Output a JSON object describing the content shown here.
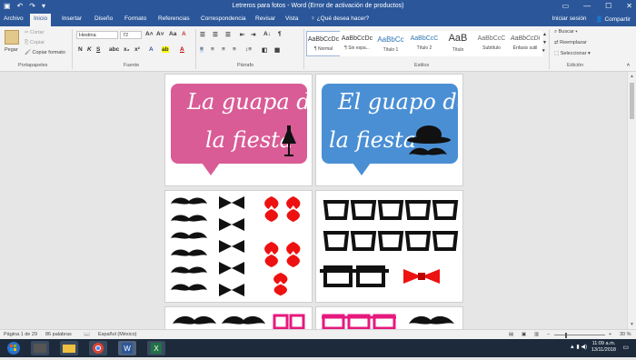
{
  "window": {
    "title": "Letreros para fotos - Word (Error de activación de productos)"
  },
  "tabs": [
    "Archivo",
    "Inicio",
    "Insertar",
    "Diseño",
    "Formato",
    "Referencias",
    "Correspondencia",
    "Revisar",
    "Vista"
  ],
  "tell_me": "¿Qué desea hacer?",
  "account": {
    "signin": "Iniciar sesión",
    "share": "Compartir"
  },
  "clipboard": {
    "paste": "Pegar",
    "cut": "Cortar",
    "copy": "Copiar",
    "format_painter": "Copiar formato",
    "label": "Portapapeles"
  },
  "font": {
    "name": "Hestina",
    "size": "72",
    "label": "Fuente"
  },
  "paragraph": {
    "label": "Párrafo"
  },
  "styles": {
    "label": "Estilos",
    "items": [
      {
        "preview": "AaBbCcDc",
        "name": "¶ Normal"
      },
      {
        "preview": "AaBbCcDc",
        "name": "¶ Sin espa..."
      },
      {
        "preview": "AaBbCc",
        "name": "Título 1"
      },
      {
        "preview": "AaBbCcC",
        "name": "Título 2"
      },
      {
        "preview": "AaB",
        "name": "Título"
      },
      {
        "preview": "AaBbCcC",
        "name": "Subtítulo"
      },
      {
        "preview": "AaBbCcDi",
        "name": "Énfasis sutil"
      }
    ]
  },
  "editing": {
    "find": "Buscar",
    "replace": "Reemplazar",
    "select": "Seleccionar",
    "label": "Edición"
  },
  "doc": {
    "sign1": {
      "line1": "La guapa de",
      "line2": "la fiesta",
      "color": "#d95c96"
    },
    "sign2": {
      "line1": "El guapo de",
      "line2": "la fiesta",
      "color": "#4a8fd4"
    }
  },
  "status": {
    "page": "Página 1 de 29",
    "words": "86 palabras",
    "language": "Español (México)",
    "zoom": "30 %"
  },
  "clock": {
    "time": "11:09 a.m.",
    "date": "13/11/2018"
  },
  "icons": [
    "save-icon",
    "undo-icon",
    "redo-icon",
    "search-icon",
    "person-icon",
    "windows-icon",
    "folder-icon",
    "chrome-icon",
    "word-icon",
    "excel-icon"
  ]
}
